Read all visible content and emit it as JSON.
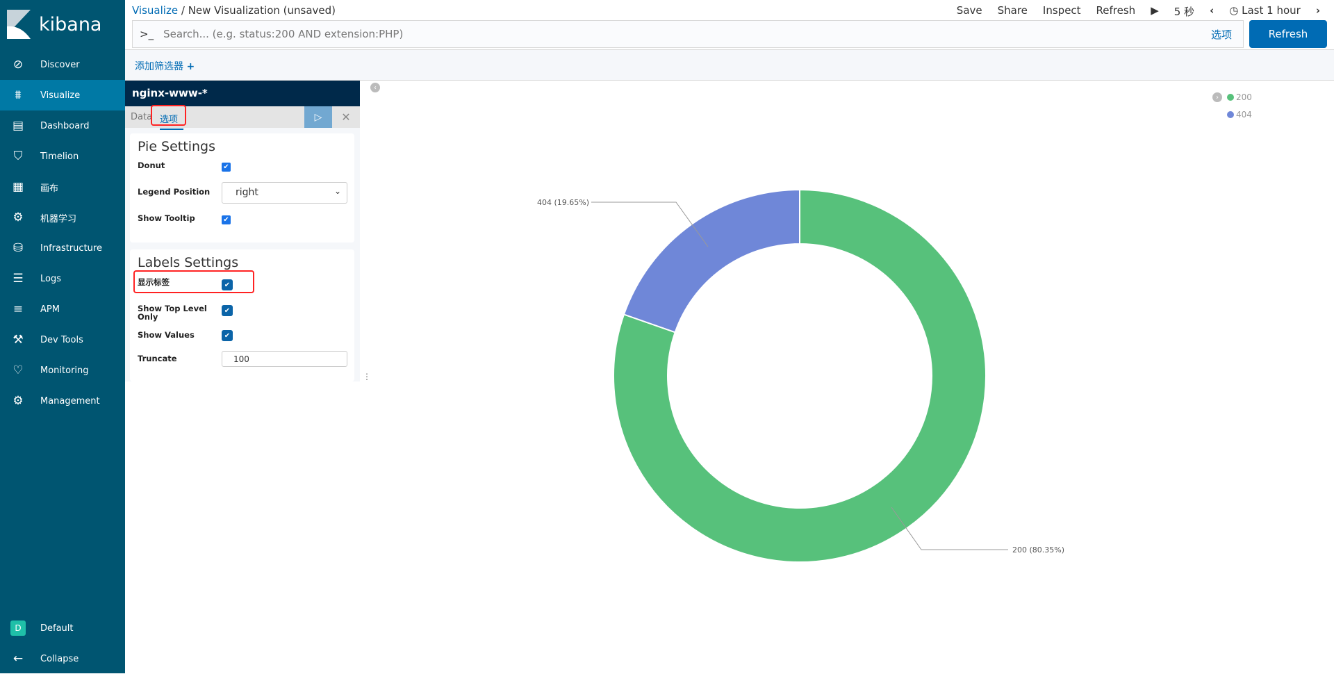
{
  "app": {
    "name": "kibana"
  },
  "sidebar": {
    "items": [
      {
        "label": "Discover",
        "icon": "compass-icon",
        "glyph": "⊘"
      },
      {
        "label": "Visualize",
        "icon": "visualize-icon",
        "glyph": "⩩",
        "active": true
      },
      {
        "label": "Dashboard",
        "icon": "dashboard-icon",
        "glyph": "▤"
      },
      {
        "label": "Timelion",
        "icon": "timelion-icon",
        "glyph": "⛉"
      },
      {
        "label": "画布",
        "icon": "canvas-icon",
        "glyph": "▦"
      },
      {
        "label": "机器学习",
        "icon": "machine-learning-icon",
        "glyph": "⚙"
      },
      {
        "label": "Infrastructure",
        "icon": "infrastructure-icon",
        "glyph": "⛁"
      },
      {
        "label": "Logs",
        "icon": "logs-icon",
        "glyph": "☰"
      },
      {
        "label": "APM",
        "icon": "apm-icon",
        "glyph": "≡"
      },
      {
        "label": "Dev Tools",
        "icon": "wrench-icon",
        "glyph": "⚒"
      },
      {
        "label": "Monitoring",
        "icon": "heartbeat-icon",
        "glyph": "♡"
      },
      {
        "label": "Management",
        "icon": "gear-icon",
        "glyph": "⚙"
      }
    ],
    "space": {
      "initial": "D",
      "label": "Default"
    },
    "collapse": {
      "label": "Collapse"
    }
  },
  "breadcrumb": {
    "parent": "Visualize",
    "sep": "/",
    "current": "New Visualization (unsaved)"
  },
  "topmenu": {
    "save": "Save",
    "share": "Share",
    "inspect": "Inspect",
    "refresh": "Refresh",
    "interval": "5 秒",
    "time": "Last 1 hour"
  },
  "search": {
    "placeholder": "Search... (e.g. status:200 AND extension:PHP)",
    "options": "选项",
    "refresh_button": "Refresh"
  },
  "filter": {
    "add": "添加筛选器"
  },
  "panel": {
    "index": "nginx-www-*",
    "tabs": [
      "Data",
      "选项"
    ],
    "pie": {
      "title": "Pie Settings",
      "donut": "Donut",
      "donut_checked": true,
      "legend_position": "Legend Position",
      "legend_value": "right",
      "show_tooltip": "Show Tooltip",
      "tooltip_checked": true
    },
    "labels": {
      "title": "Labels Settings",
      "show_labels": "显示标签",
      "show_top": "Show Top Level Only",
      "show_values": "Show Values",
      "truncate": "Truncate",
      "truncate_value": "100"
    }
  },
  "chart_data": {
    "type": "pie",
    "donut": true,
    "legend_position": "right",
    "categories": [
      "200",
      "404"
    ],
    "values": [
      80.35,
      19.65
    ],
    "labels": [
      "200 (80.35%)",
      "404 (19.65%)"
    ],
    "colors": [
      "#57c17b",
      "#6f87d8"
    ]
  }
}
